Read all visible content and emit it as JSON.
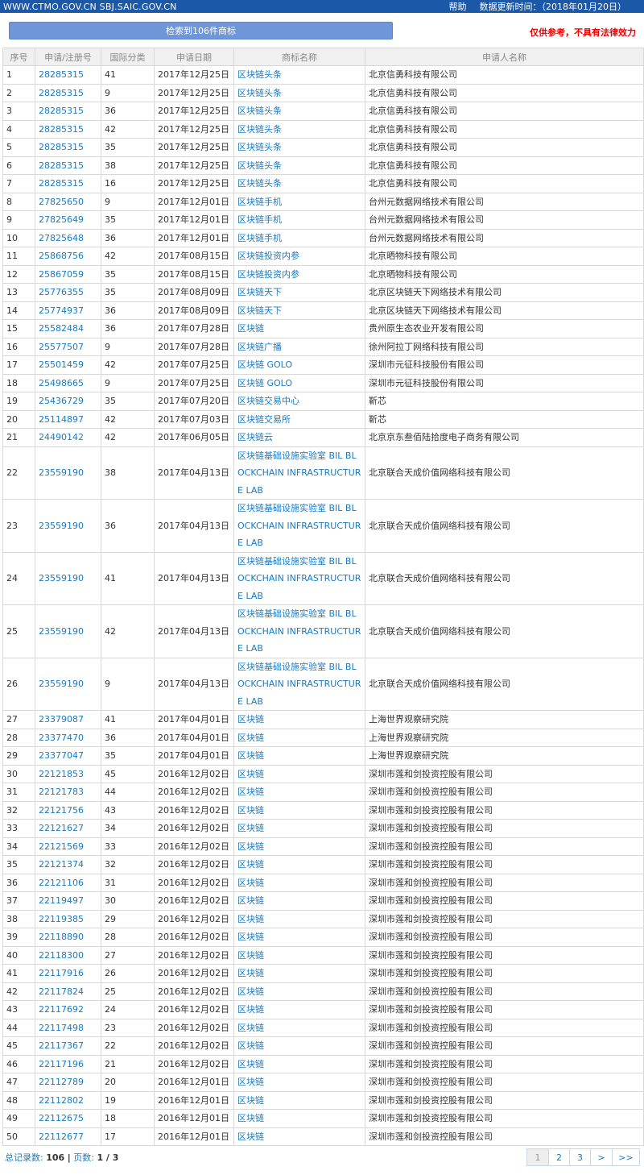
{
  "topbar": {
    "site": "WWW.CTMO.GOV.CN SBJ.SAIC.GOV.CN",
    "help": "帮助",
    "update": "数据更新时间：（2018年01月20日）"
  },
  "search": {
    "result_label": "检索到106件商标",
    "disclaimer": "仅供参考，不具有法律效力"
  },
  "table": {
    "headers": [
      "序号",
      "申请/注册号",
      "国际分类",
      "申请日期",
      "商标名称",
      "申请人名称"
    ],
    "rows": [
      [
        "1",
        "28285315",
        "41",
        "2017年12月25日",
        "区块链头条",
        "北京信勇科技有限公司"
      ],
      [
        "2",
        "28285315",
        "9",
        "2017年12月25日",
        "区块链头条",
        "北京信勇科技有限公司"
      ],
      [
        "3",
        "28285315",
        "36",
        "2017年12月25日",
        "区块链头条",
        "北京信勇科技有限公司"
      ],
      [
        "4",
        "28285315",
        "42",
        "2017年12月25日",
        "区块链头条",
        "北京信勇科技有限公司"
      ],
      [
        "5",
        "28285315",
        "35",
        "2017年12月25日",
        "区块链头条",
        "北京信勇科技有限公司"
      ],
      [
        "6",
        "28285315",
        "38",
        "2017年12月25日",
        "区块链头条",
        "北京信勇科技有限公司"
      ],
      [
        "7",
        "28285315",
        "16",
        "2017年12月25日",
        "区块链头条",
        "北京信勇科技有限公司"
      ],
      [
        "8",
        "27825650",
        "9",
        "2017年12月01日",
        "区块链手机",
        "台州元数据网络技术有限公司"
      ],
      [
        "9",
        "27825649",
        "35",
        "2017年12月01日",
        "区块链手机",
        "台州元数据网络技术有限公司"
      ],
      [
        "10",
        "27825648",
        "36",
        "2017年12月01日",
        "区块链手机",
        "台州元数据网络技术有限公司"
      ],
      [
        "11",
        "25868756",
        "42",
        "2017年08月15日",
        "区块链投资内参",
        "北京晒物科技有限公司"
      ],
      [
        "12",
        "25867059",
        "35",
        "2017年08月15日",
        "区块链投资内参",
        "北京晒物科技有限公司"
      ],
      [
        "13",
        "25776355",
        "35",
        "2017年08月09日",
        "区块链天下",
        "北京区块链天下网络技术有限公司"
      ],
      [
        "14",
        "25774937",
        "36",
        "2017年08月09日",
        "区块链天下",
        "北京区块链天下网络技术有限公司"
      ],
      [
        "15",
        "25582484",
        "36",
        "2017年07月28日",
        "区块链",
        "贵州原生态农业开发有限公司"
      ],
      [
        "16",
        "25577507",
        "9",
        "2017年07月28日",
        "区块链广播",
        "徐州阿拉丁网络科技有限公司"
      ],
      [
        "17",
        "25501459",
        "42",
        "2017年07月25日",
        "区块链 GOLO",
        "深圳市元征科技股份有限公司"
      ],
      [
        "18",
        "25498665",
        "9",
        "2017年07月25日",
        "区块链 GOLO",
        "深圳市元征科技股份有限公司"
      ],
      [
        "19",
        "25436729",
        "35",
        "2017年07月20日",
        "区块链交易中心",
        "靳芯"
      ],
      [
        "20",
        "25114897",
        "42",
        "2017年07月03日",
        "区块链交易所",
        "靳芯"
      ],
      [
        "21",
        "24490142",
        "42",
        "2017年06月05日",
        "区块链云",
        "北京京东叁佰陆拾度电子商务有限公司"
      ],
      [
        "22",
        "23559190",
        "38",
        "2017年04月13日",
        "区块链基础设施实验室 BIL BLOCKCHAIN INFRASTRUCTURE LAB",
        "北京联合天成价值网络科技有限公司"
      ],
      [
        "23",
        "23559190",
        "36",
        "2017年04月13日",
        "区块链基础设施实验室 BIL BLOCKCHAIN INFRASTRUCTURE LAB",
        "北京联合天成价值网络科技有限公司"
      ],
      [
        "24",
        "23559190",
        "41",
        "2017年04月13日",
        "区块链基础设施实验室 BIL BLOCKCHAIN INFRASTRUCTURE LAB",
        "北京联合天成价值网络科技有限公司"
      ],
      [
        "25",
        "23559190",
        "42",
        "2017年04月13日",
        "区块链基础设施实验室 BIL BLOCKCHAIN INFRASTRUCTURE LAB",
        "北京联合天成价值网络科技有限公司"
      ],
      [
        "26",
        "23559190",
        "9",
        "2017年04月13日",
        "区块链基础设施实验室 BIL BLOCKCHAIN INFRASTRUCTURE LAB",
        "北京联合天成价值网络科技有限公司"
      ],
      [
        "27",
        "23379087",
        "41",
        "2017年04月01日",
        "区块链",
        "上海世界观察研究院"
      ],
      [
        "28",
        "23377470",
        "36",
        "2017年04月01日",
        "区块链",
        "上海世界观察研究院"
      ],
      [
        "29",
        "23377047",
        "35",
        "2017年04月01日",
        "区块链",
        "上海世界观察研究院"
      ],
      [
        "30",
        "22121853",
        "45",
        "2016年12月02日",
        "区块链",
        "深圳市莲和剑投资控股有限公司"
      ],
      [
        "31",
        "22121783",
        "44",
        "2016年12月02日",
        "区块链",
        "深圳市莲和剑投资控股有限公司"
      ],
      [
        "32",
        "22121756",
        "43",
        "2016年12月02日",
        "区块链",
        "深圳市莲和剑投资控股有限公司"
      ],
      [
        "33",
        "22121627",
        "34",
        "2016年12月02日",
        "区块链",
        "深圳市莲和剑投资控股有限公司"
      ],
      [
        "34",
        "22121569",
        "33",
        "2016年12月02日",
        "区块链",
        "深圳市莲和剑投资控股有限公司"
      ],
      [
        "35",
        "22121374",
        "32",
        "2016年12月02日",
        "区块链",
        "深圳市莲和剑投资控股有限公司"
      ],
      [
        "36",
        "22121106",
        "31",
        "2016年12月02日",
        "区块链",
        "深圳市莲和剑投资控股有限公司"
      ],
      [
        "37",
        "22119497",
        "30",
        "2016年12月02日",
        "区块链",
        "深圳市莲和剑投资控股有限公司"
      ],
      [
        "38",
        "22119385",
        "29",
        "2016年12月02日",
        "区块链",
        "深圳市莲和剑投资控股有限公司"
      ],
      [
        "39",
        "22118890",
        "28",
        "2016年12月02日",
        "区块链",
        "深圳市莲和剑投资控股有限公司"
      ],
      [
        "40",
        "22118300",
        "27",
        "2016年12月02日",
        "区块链",
        "深圳市莲和剑投资控股有限公司"
      ],
      [
        "41",
        "22117916",
        "26",
        "2016年12月02日",
        "区块链",
        "深圳市莲和剑投资控股有限公司"
      ],
      [
        "42",
        "22117824",
        "25",
        "2016年12月02日",
        "区块链",
        "深圳市莲和剑投资控股有限公司"
      ],
      [
        "43",
        "22117692",
        "24",
        "2016年12月02日",
        "区块链",
        "深圳市莲和剑投资控股有限公司"
      ],
      [
        "44",
        "22117498",
        "23",
        "2016年12月02日",
        "区块链",
        "深圳市莲和剑投资控股有限公司"
      ],
      [
        "45",
        "22117367",
        "22",
        "2016年12月02日",
        "区块链",
        "深圳市莲和剑投资控股有限公司"
      ],
      [
        "46",
        "22117196",
        "21",
        "2016年12月02日",
        "区块链",
        "深圳市莲和剑投资控股有限公司"
      ],
      [
        "47",
        "22112789",
        "20",
        "2016年12月01日",
        "区块链",
        "深圳市莲和剑投资控股有限公司"
      ],
      [
        "48",
        "22112802",
        "19",
        "2016年12月01日",
        "区块链",
        "深圳市莲和剑投资控股有限公司"
      ],
      [
        "49",
        "22112675",
        "18",
        "2016年12月01日",
        "区块链",
        "深圳市莲和剑投资控股有限公司"
      ],
      [
        "50",
        "22112677",
        "17",
        "2016年12月01日",
        "区块链",
        "深圳市莲和剑投资控股有限公司"
      ]
    ]
  },
  "footer": {
    "total_label": "总记录数:",
    "total_value": "106",
    "separator": "|",
    "pages_label": "页数:",
    "pages_value": "1 / 3",
    "pager": [
      "1",
      "2",
      "3",
      ">",
      ">>"
    ]
  }
}
